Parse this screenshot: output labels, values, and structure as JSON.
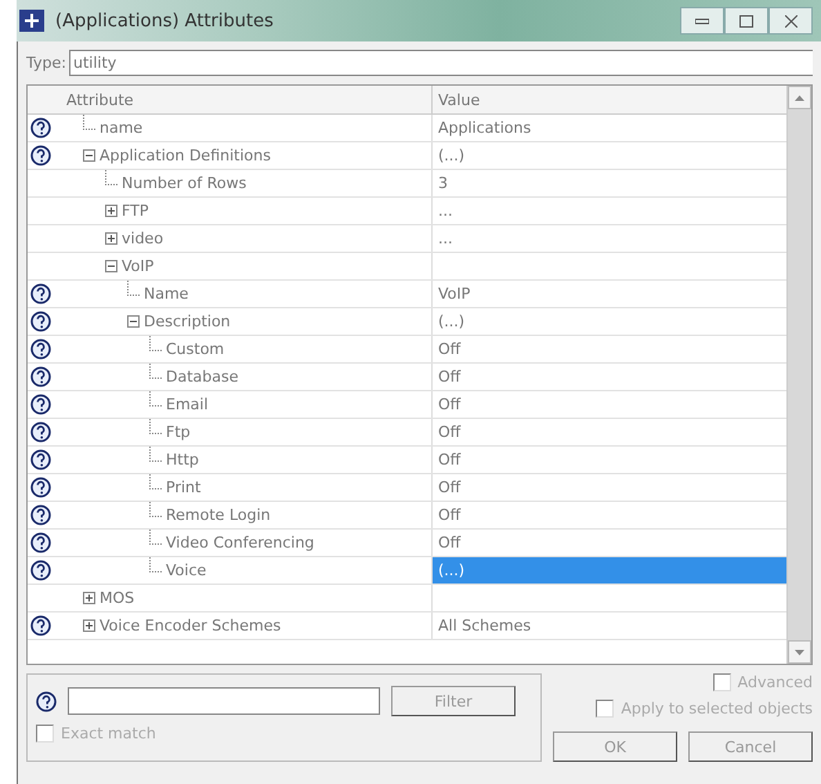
{
  "window": {
    "title": "(Applications) Attributes"
  },
  "type_field": {
    "label": "Type:",
    "value": "utility"
  },
  "table": {
    "columns": [
      "Attribute",
      "Value"
    ],
    "rows": [
      {
        "label": "name",
        "value": "Applications",
        "help": true,
        "selected": false
      },
      {
        "label": "Application Definitions",
        "value": "(...)",
        "help": true,
        "expanded": true,
        "selected": false,
        "children": [
          {
            "label": "Number of Rows",
            "value": "3",
            "help": false,
            "selected": false
          },
          {
            "label": "FTP",
            "value": "...",
            "help": false,
            "expanded": false,
            "selected": false
          },
          {
            "label": "video",
            "value": "...",
            "help": false,
            "expanded": false,
            "selected": false
          },
          {
            "label": "VoIP",
            "help": false,
            "expanded": true,
            "selected": false,
            "children": [
              {
                "label": "Name",
                "value": "VoIP",
                "help": true,
                "selected": false
              },
              {
                "label": "Description",
                "value": "(...)",
                "help": true,
                "expanded": true,
                "selected": false,
                "children": [
                  {
                    "label": "Custom",
                    "value": "Off",
                    "help": true,
                    "selected": false
                  },
                  {
                    "label": "Database",
                    "value": "Off",
                    "help": true,
                    "selected": false
                  },
                  {
                    "label": "Email",
                    "value": "Off",
                    "help": true,
                    "selected": false
                  },
                  {
                    "label": "Ftp",
                    "value": "Off",
                    "help": true,
                    "selected": false
                  },
                  {
                    "label": "Http",
                    "value": "Off",
                    "help": true,
                    "selected": false
                  },
                  {
                    "label": "Print",
                    "value": "Off",
                    "help": true,
                    "selected": false
                  },
                  {
                    "label": "Remote Login",
                    "value": "Off",
                    "help": true,
                    "selected": false
                  },
                  {
                    "label": "Video Conferencing",
                    "value": "Off",
                    "help": true,
                    "selected": false
                  },
                  {
                    "label": "Voice",
                    "value": "(...)",
                    "help": true,
                    "selected": true
                  }
                ]
              }
            ]
          }
        ]
      },
      {
        "label": "MOS",
        "help": false,
        "expanded": false,
        "selected": false
      },
      {
        "label": "Voice Encoder Schemes",
        "value": "All Schemes",
        "help": true,
        "expanded": false,
        "selected": false
      }
    ]
  },
  "filter": {
    "button": "Filter",
    "exact_match": {
      "label": "Exact match",
      "checked": false
    }
  },
  "options": [
    {
      "label": "Advanced",
      "checked": false
    },
    {
      "label": "Apply to selected objects",
      "checked": false
    }
  ],
  "buttons": [
    "OK",
    "Cancel"
  ]
}
